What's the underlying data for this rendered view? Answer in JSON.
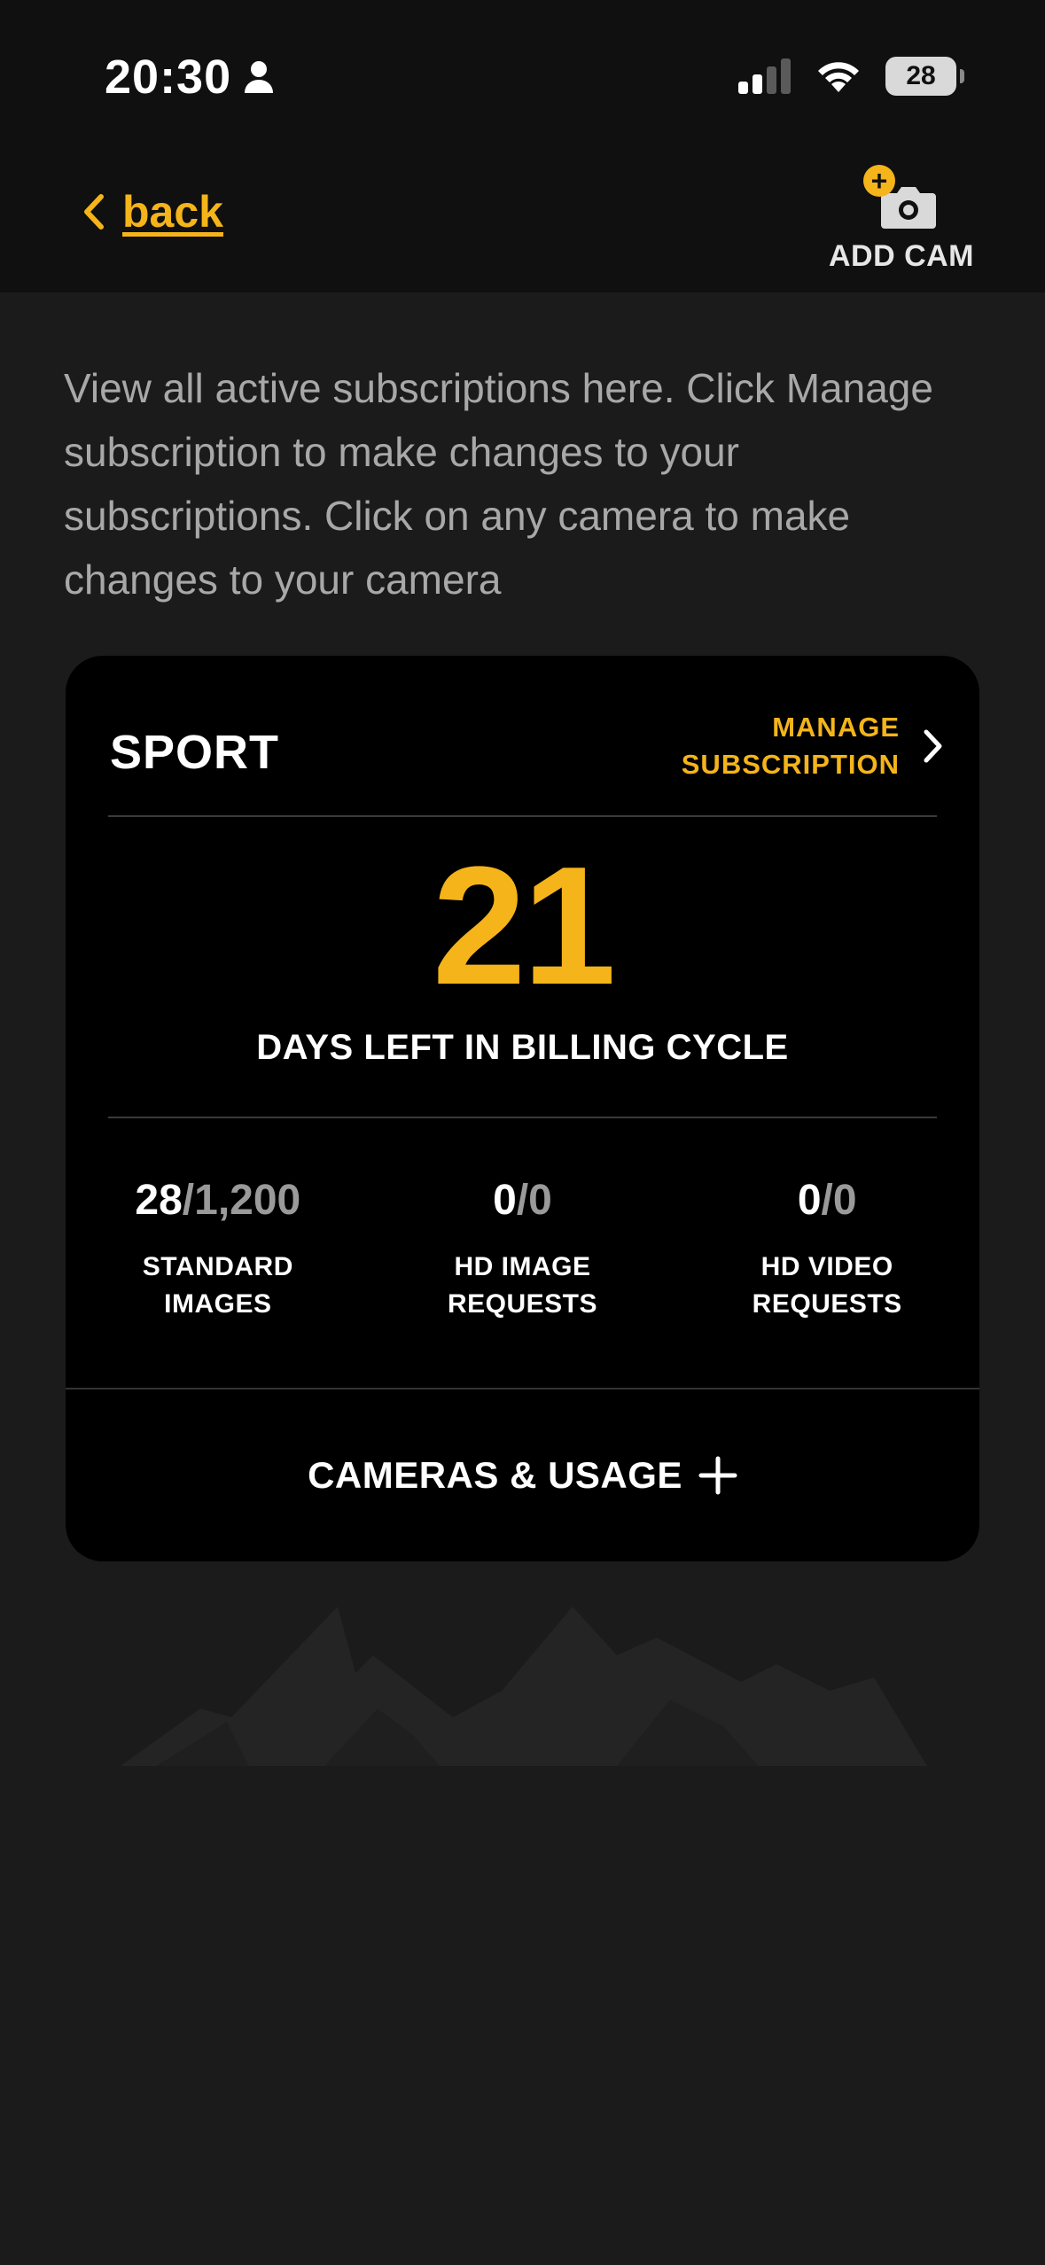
{
  "status_bar": {
    "time": "20:30",
    "battery": "28"
  },
  "nav": {
    "back_label": "back",
    "add_cam_label": "ADD CAM"
  },
  "intro_text": "View all active subscriptions here. Click Manage subscription to make changes to your subscriptions. Click on any camera to make changes to your camera",
  "subscription": {
    "plan_name": "SPORT",
    "manage_line1": "MANAGE",
    "manage_line2": "SUBSCRIPTION",
    "days_left": "21",
    "days_label": "DAYS LEFT IN BILLING CYCLE",
    "stats": [
      {
        "used": "28",
        "total": "/1,200",
        "label_line1": "STANDARD",
        "label_line2": "IMAGES"
      },
      {
        "used": "0",
        "total": "/0",
        "label_line1": "HD IMAGE",
        "label_line2": "REQUESTS"
      },
      {
        "used": "0",
        "total": "/0",
        "label_line1": "HD VIDEO",
        "label_line2": "REQUESTS"
      }
    ],
    "usage_label": "CAMERAS & USAGE"
  },
  "colors": {
    "accent": "#f4b41a",
    "background": "#1b1b1b",
    "card": "#000000"
  }
}
